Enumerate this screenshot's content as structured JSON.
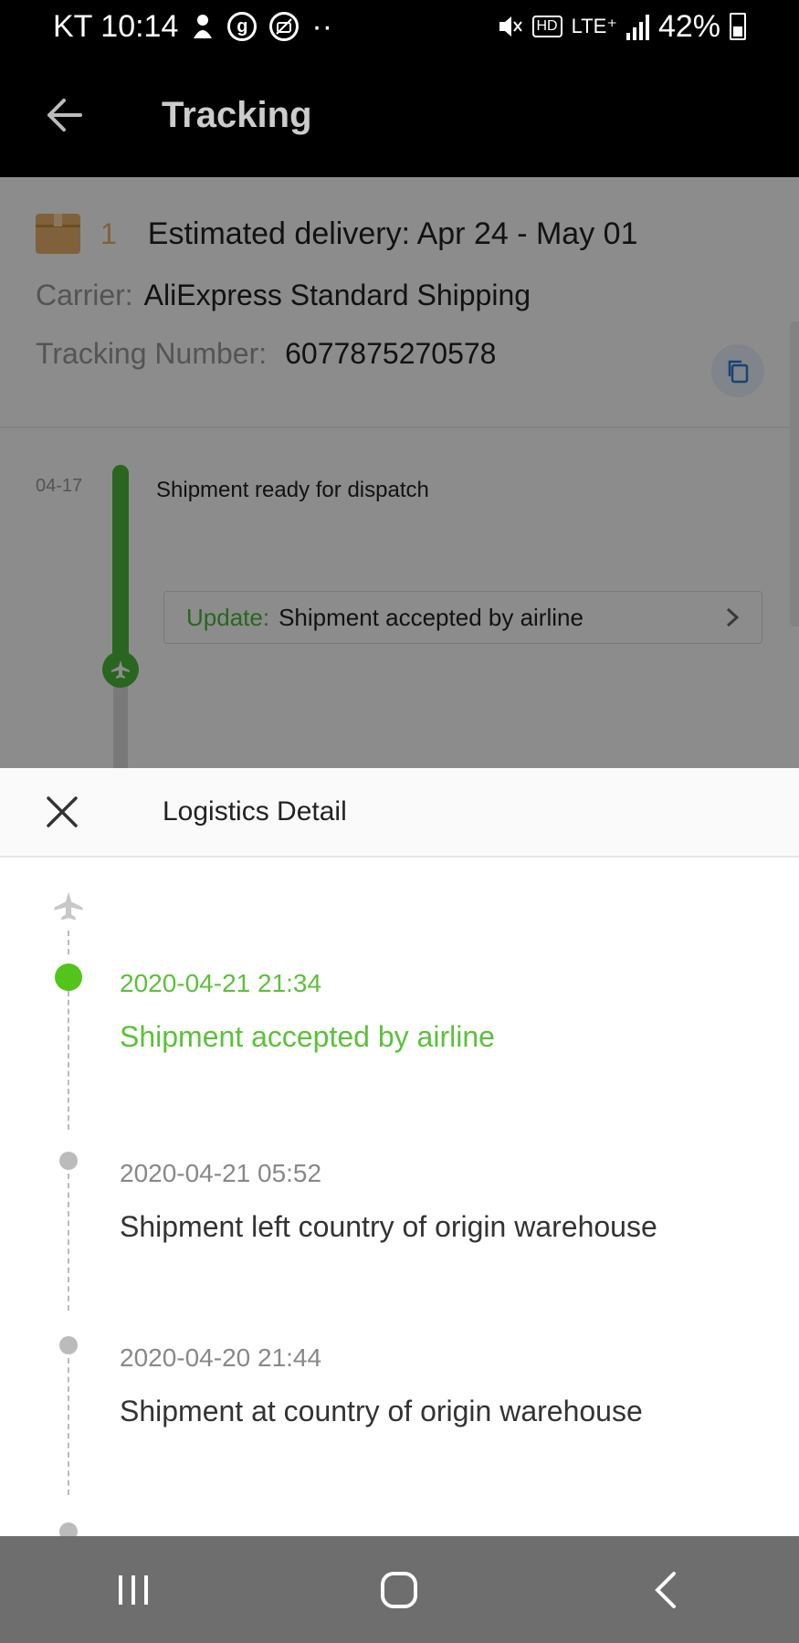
{
  "status_bar": {
    "carrier_time": "KT 10:14",
    "network": "LTE⁺",
    "hd": "HD",
    "battery": "42%"
  },
  "app_bar": {
    "title": "Tracking"
  },
  "package": {
    "count": "1",
    "estimated_delivery": "Estimated delivery: Apr 24 - May 01",
    "carrier_label": "Carrier:",
    "carrier_value": "AliExpress Standard Shipping",
    "tracking_label": "Tracking Number:",
    "tracking_value": "6077875270578"
  },
  "timeline_preview": {
    "date": "04-17",
    "status": "Shipment ready for dispatch",
    "update_label": "Update:",
    "update_text": "Shipment accepted by airline"
  },
  "sheet": {
    "title": "Logistics Detail",
    "events": [
      {
        "time": "2020-04-21 21:34",
        "desc": "Shipment accepted by airline",
        "active": true
      },
      {
        "time": "2020-04-21 05:52",
        "desc": "Shipment left country of origin warehouse",
        "active": false
      },
      {
        "time": "2020-04-20 21:44",
        "desc": "Shipment at country of origin warehouse",
        "active": false
      }
    ]
  },
  "colors": {
    "accent_green": "#4cbb3a",
    "active_text": "#5cc13b",
    "box": "#e8b36c"
  },
  "icons": [
    "back-arrow-icon",
    "box-icon",
    "copy-icon",
    "chevron-right-icon",
    "close-icon",
    "plane-icon",
    "recent-apps-icon",
    "home-icon",
    "nav-back-icon"
  ]
}
